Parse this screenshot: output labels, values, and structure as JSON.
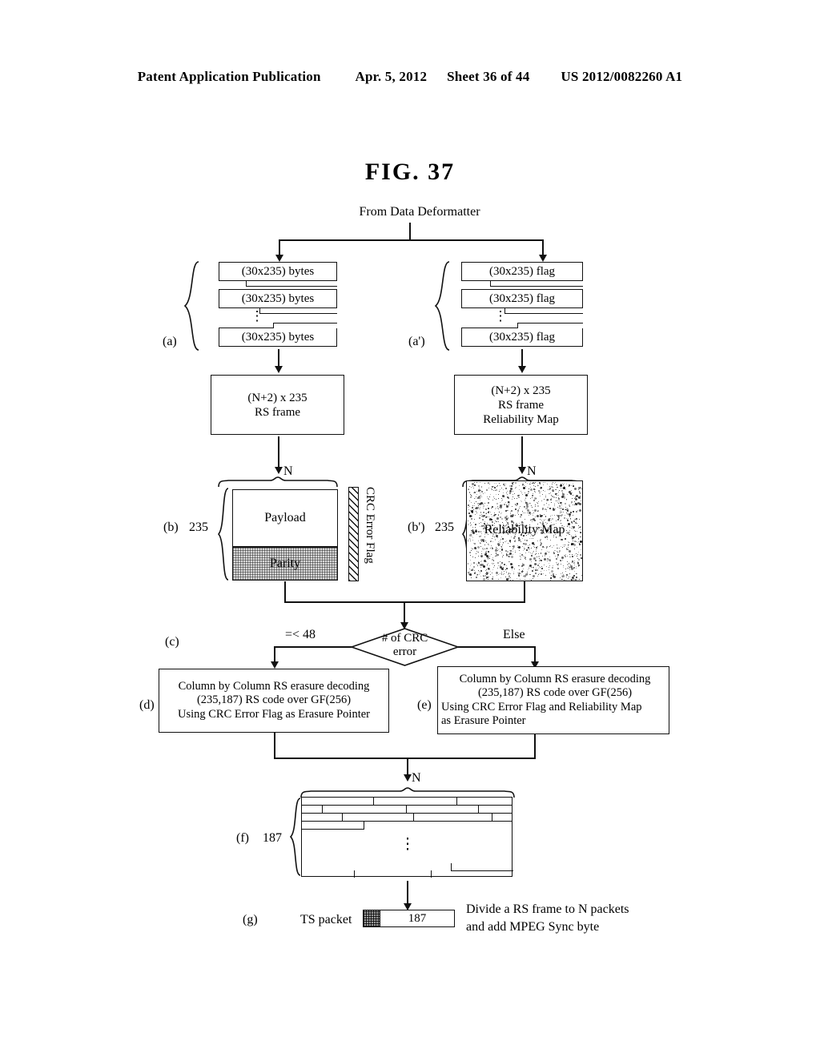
{
  "page_header": {
    "publication": "Patent Application Publication",
    "date": "Apr. 5, 2012",
    "sheet": "Sheet 36 of 44",
    "patent_number": "US 2012/0082260 A1"
  },
  "figure": {
    "title": "FIG. 37",
    "source_label": "From Data Deformatter"
  },
  "stage_a": {
    "tag": "(a)",
    "strips": [
      {
        "label": "(30x235) bytes"
      },
      {
        "label": "(30x235) bytes"
      },
      {
        "label": "(30x235) bytes"
      }
    ],
    "dots": "⋮",
    "frame_box": "(N+2) x 235\nRS frame",
    "frame_line1": "(N+2) x 235",
    "frame_line2": "RS frame"
  },
  "stage_a_prime": {
    "tag": "(a')",
    "strips": [
      {
        "label": "(30x235) flag"
      },
      {
        "label": "(30x235) flag"
      },
      {
        "label": "(30x235) flag"
      }
    ],
    "dots": "⋮",
    "frame_line1": "(N+2) x 235",
    "frame_line2": "RS frame",
    "frame_line3": "Reliability Map"
  },
  "stage_b": {
    "tag": "(b)",
    "rows_label": "235",
    "cols_label": "N",
    "payload_label": "Payload",
    "parity_label": "Parity",
    "crc_flag_label": "CRC Error Flag"
  },
  "stage_b_prime": {
    "tag": "(b')",
    "rows_label": "235",
    "cols_label": "N",
    "map_label": "Reliability Map"
  },
  "stage_c": {
    "tag": "(c)",
    "decision_line1": "# of CRC",
    "decision_line2": "error",
    "branch_left": "=< 48",
    "branch_right": "Else"
  },
  "stage_d": {
    "tag": "(d)",
    "line1": "Column by Column RS erasure decoding",
    "line2": "(235,187) RS code over GF(256)",
    "line3": "Using CRC Error Flag as Erasure Pointer"
  },
  "stage_e": {
    "tag": "(e)",
    "line1": "Column by Column RS erasure decoding",
    "line2": "(235,187) RS code over GF(256)",
    "line3": "Using CRC Error Flag and Reliability Map",
    "line4": "as Erasure Pointer"
  },
  "stage_f": {
    "tag": "(f)",
    "rows_label": "187",
    "cols_label": "N",
    "dots": "⋮"
  },
  "stage_g": {
    "tag": "(g)",
    "ts_packet_label": "TS packet",
    "payload_size": "187",
    "note_line1": "Divide a RS frame to N packets",
    "note_line2": "and add MPEG Sync byte"
  },
  "colors": {
    "ink": "#111111",
    "paper": "#ffffff",
    "parity_fill": "#d9d9d9",
    "sync_fill": "#9a9a9a"
  }
}
